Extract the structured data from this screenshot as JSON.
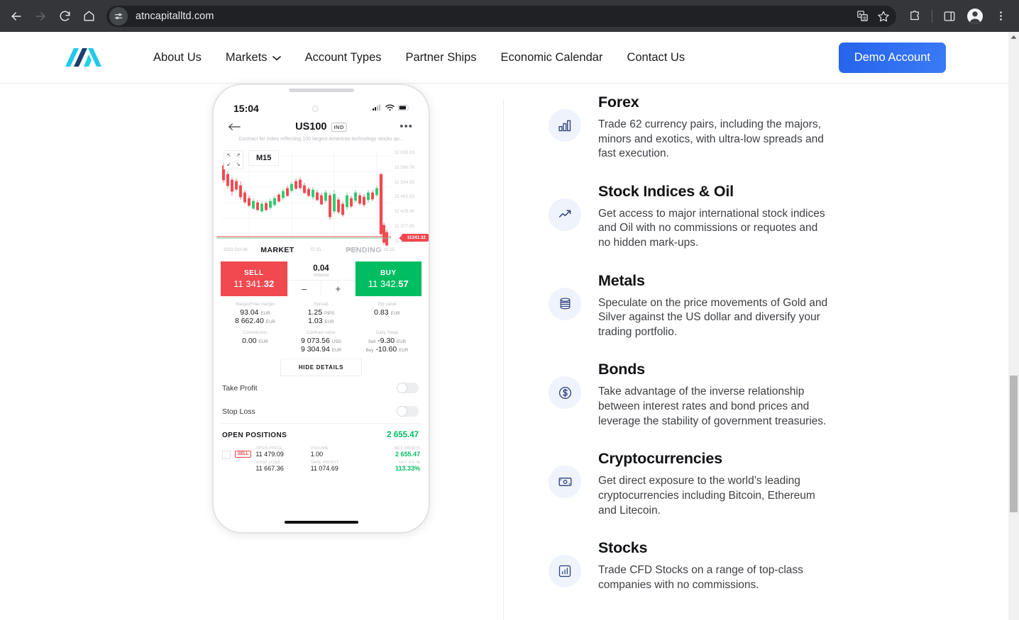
{
  "browser": {
    "url": "atncapitalltd.com",
    "back_label": "Back",
    "forward_label": "Forward",
    "reload_label": "Reload",
    "home_label": "Home",
    "site_info_label": "View site information",
    "translate_label": "Translate this page",
    "bookmark_label": "Bookmark this tab",
    "extensions_label": "Extensions",
    "side_panel_label": "Side panel",
    "profile_label": "Profile",
    "menu_label": "Customize and control Google Chrome"
  },
  "header": {
    "logo_name": "atn-capital-logo",
    "nav": [
      {
        "label": "About Us",
        "has_dropdown": false
      },
      {
        "label": "Markets",
        "has_dropdown": true
      },
      {
        "label": "Account Types",
        "has_dropdown": false
      },
      {
        "label": "Partner Ships",
        "has_dropdown": false
      },
      {
        "label": "Economic Calendar",
        "has_dropdown": false
      },
      {
        "label": "Contact Us",
        "has_dropdown": false
      }
    ],
    "cta_label": "Demo Account",
    "cta_color": "#2563eb"
  },
  "phone": {
    "status": {
      "time": "15:04"
    },
    "title": {
      "symbol": "US100",
      "badge": "IND",
      "subtitle": "Contract for index reflecting 100 largest American technology stocks qu...",
      "back_icon": "arrow-left-icon",
      "more_icon": "more-horizontal-icon"
    },
    "chart": {
      "timeframe": "M15",
      "price_labels": [
        "11 639.19",
        "11 586.76",
        "11 534.33",
        "11 481.91",
        "11 429.48",
        "11 377.05",
        "11 324.62"
      ],
      "current_price_badge": "11341.32",
      "time_labels": [
        "2022 Oct 06",
        "03:15",
        "07:15",
        "11:15",
        "15:15"
      ]
    },
    "tabs": [
      {
        "label": "MARKET",
        "active": true
      },
      {
        "label": "PENDING",
        "active": false
      }
    ],
    "trade": {
      "sell_label": "SELL",
      "sell_price_main": "11 341.",
      "sell_price_dec": "32",
      "buy_label": "BUY",
      "buy_price_main": "11 342.",
      "buy_price_dec": "57",
      "volume_value": "0.04",
      "volume_caption": "Volume",
      "minus_label": "–",
      "plus_label": "+",
      "sell_color": "#f2484f",
      "buy_color": "#00bd62"
    },
    "info": [
      {
        "caption": "Margin/Free margin",
        "line1_value": "93.04",
        "line1_unit": "EUR",
        "line2_value": "8 662.40",
        "line2_unit": "EUR"
      },
      {
        "caption": "Spread",
        "line1_value": "1.25",
        "line1_unit": "PIPS",
        "line2_value": "1.03",
        "line2_unit": "EUR"
      },
      {
        "caption": "Pip value",
        "line1_value": "0.83",
        "line1_unit": "EUR",
        "line2_value": "",
        "line2_unit": ""
      },
      {
        "caption": "Commission",
        "line1_value": "0.00",
        "line1_unit": "EUR",
        "line2_value": "",
        "line2_unit": ""
      },
      {
        "caption": "Contract value",
        "line1_value": "9 073.56",
        "line1_unit": "USD",
        "line2_value": "9 304.94",
        "line2_unit": "EUR"
      },
      {
        "caption": "Daily Swap",
        "line1_prefix": "Sell",
        "line1_value": "-9.30",
        "line1_unit": "EUR",
        "line2_prefix": "Buy",
        "line2_value": "-10.60",
        "line2_unit": "EUR"
      }
    ],
    "hide_details_label": "HIDE DETAILS",
    "toggles": [
      {
        "label": "Take Profit",
        "on": false
      },
      {
        "label": "Stop Loss",
        "on": false
      }
    ],
    "positions": {
      "title": "OPEN POSITIONS",
      "total": "2 655.47",
      "row": {
        "tag": "SELL",
        "cells": [
          {
            "caption": "OPEN PRICE",
            "value": "11 479.09"
          },
          {
            "caption": "VOLUME",
            "value": "1.00"
          },
          {
            "caption": "NET PROFIT",
            "value": "2 655.47",
            "green": true
          },
          {
            "caption": "STOP LOSS",
            "value": "11 667.36"
          },
          {
            "caption": "TAKE PROFIT",
            "value": "11 074.69"
          },
          {
            "caption": "NET P/L %",
            "value": "113.33%",
            "green": true
          }
        ]
      }
    }
  },
  "features": [
    {
      "icon": "bar-chart-icon",
      "title": "Forex",
      "description": "Trade 62 currency pairs, including the majors, minors and exotics, with ultra-low spreads and fast execution."
    },
    {
      "icon": "trending-up-icon",
      "title": "Stock Indices & Oil",
      "description": "Get access to major international stock indices and Oil with no commissions or requotes and no hidden mark-ups."
    },
    {
      "icon": "layers-icon",
      "title": "Metals",
      "description": "Speculate on the price movements of Gold and Silver against the US dollar and diversify your trading portfolio."
    },
    {
      "icon": "dollar-circle-icon",
      "title": "Bonds",
      "description": "Take advantage of the inverse relationship between interest rates and bond prices and leverage the stability of government treasuries."
    },
    {
      "icon": "banknote-icon",
      "title": "Cryptocurrencies",
      "description": "Get direct exposure to the world’s leading cryptocurrencies including Bitcoin, Ethereum and Litecoin."
    },
    {
      "icon": "chart-square-icon",
      "title": "Stocks",
      "description": "Trade CFD Stocks on a range of top-class companies with no commissions."
    }
  ]
}
